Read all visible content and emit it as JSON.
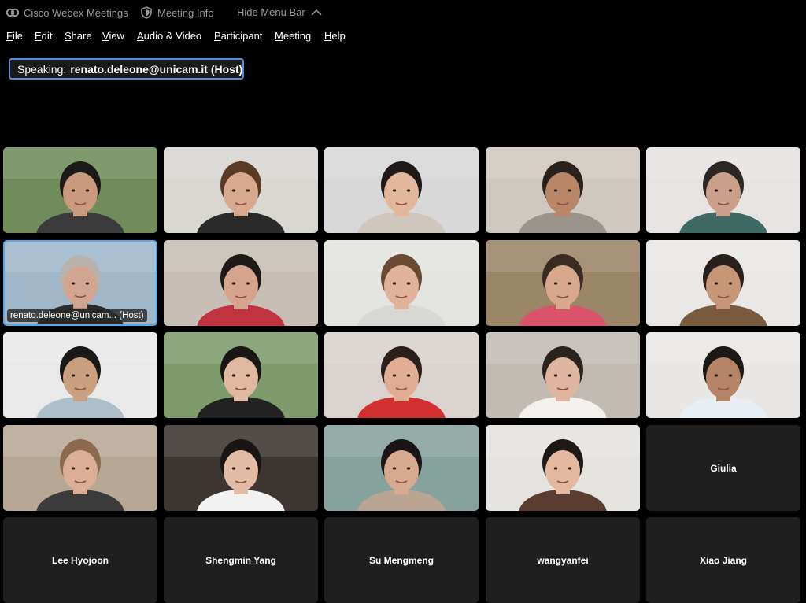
{
  "titlebar": {
    "app_name": "Cisco Webex Meetings",
    "meeting_info": "Meeting Info",
    "hide_menu_bar": "Hide Menu Bar"
  },
  "menu": [
    {
      "mnemonic": "F",
      "rest": "ile"
    },
    {
      "mnemonic": "E",
      "rest": "dit"
    },
    {
      "mnemonic": "S",
      "rest": "hare"
    },
    {
      "mnemonic": "V",
      "rest": "iew"
    },
    {
      "mnemonic": "A",
      "rest": "udio & Video"
    },
    {
      "mnemonic": "P",
      "rest": "articipant"
    },
    {
      "mnemonic": "M",
      "rest": "eeting"
    },
    {
      "mnemonic": "H",
      "rest": "elp"
    }
  ],
  "speaking": {
    "prefix": "Speaking:",
    "name": "renato.deleone@unicam.it (Host)"
  },
  "host_tile_label": "renato.deleone@unicam... (Host)",
  "video_tiles": [
    {
      "bg": "#6f8c5a",
      "skin": "#c99a7d",
      "hair": "#1c1a18",
      "shirt": "#3b3b3b"
    },
    {
      "bg": "#d9d7d2",
      "skin": "#d8a88f",
      "hair": "#5b3a26",
      "shirt": "#2a2a2a"
    },
    {
      "bg": "#d8d8d8",
      "skin": "#e2b79c",
      "hair": "#1f1a17",
      "shirt": "#cfc6bd"
    },
    {
      "bg": "#cfc8c0",
      "skin": "#b98768",
      "hair": "#2a211c",
      "shirt": "#9a948c"
    },
    {
      "bg": "#e7e3e2",
      "skin": "#caa08a",
      "hair": "#2c2724",
      "shirt": "#3f6a63"
    },
    {
      "bg": "#9fb7c9",
      "skin": "#d2a590",
      "hair": "#b8b2ac",
      "shirt": "#2c2c2c"
    },
    {
      "bg": "#c7bfb6",
      "skin": "#d6a48c",
      "hair": "#1e1a18",
      "shirt": "#c0333f"
    },
    {
      "bg": "#e3e3e0",
      "skin": "#e0b39a",
      "hair": "#6a4a33",
      "shirt": "#d8d8d6"
    },
    {
      "bg": "#9b8567",
      "skin": "#d8a88d",
      "hair": "#3a2b22",
      "shirt": "#d9546b"
    },
    {
      "bg": "#eae8e6",
      "skin": "#c79677",
      "hair": "#2a201b",
      "shirt": "#7a5a3f"
    },
    {
      "bg": "#e9e9e9",
      "skin": "#caa080",
      "hair": "#1b1918",
      "shirt": "#aebfcc"
    },
    {
      "bg": "#7d9b6b",
      "skin": "#e1b9a1",
      "hair": "#1a1615",
      "shirt": "#222222"
    },
    {
      "bg": "#d9d2cf",
      "skin": "#e0ad93",
      "hair": "#2a1f1a",
      "shirt": "#d23030"
    },
    {
      "bg": "#c2bbb4",
      "skin": "#e0b6a0",
      "hair": "#2a2320",
      "shirt": "#f3f1ee"
    },
    {
      "bg": "#e9e7e5",
      "skin": "#b58365",
      "hair": "#1c1816",
      "shirt": "#e7eef4"
    },
    {
      "bg": "#b7a894",
      "skin": "#dcae95",
      "hair": "#8c6a4e",
      "shirt": "#3b3b3b"
    },
    {
      "bg": "#3c3532",
      "skin": "#e3bca5",
      "hair": "#1a1615",
      "shirt": "#f2f2f2"
    },
    {
      "bg": "#86a29d",
      "skin": "#d7a98e",
      "hair": "#1a1615",
      "shirt": "#b9a592"
    },
    {
      "bg": "#e5e3df",
      "skin": "#e4b9a0",
      "hair": "#1e1917",
      "shirt": "#5b3c30"
    }
  ],
  "name_tiles": [
    {
      "row": 3,
      "col": 4,
      "name": "Giulia"
    },
    {
      "row": 4,
      "col": 0,
      "name": "Lee Hyojoon"
    },
    {
      "row": 4,
      "col": 1,
      "name": "Shengmin Yang"
    },
    {
      "row": 4,
      "col": 2,
      "name": "Su Mengmeng"
    },
    {
      "row": 4,
      "col": 3,
      "name": "wangyanfei"
    },
    {
      "row": 4,
      "col": 4,
      "name": "Xiao Jiang"
    }
  ],
  "colors": {
    "accent": "#4f90d8",
    "tile_empty": "#1f1f1f",
    "titlebar_text": "#9a9a9a"
  }
}
